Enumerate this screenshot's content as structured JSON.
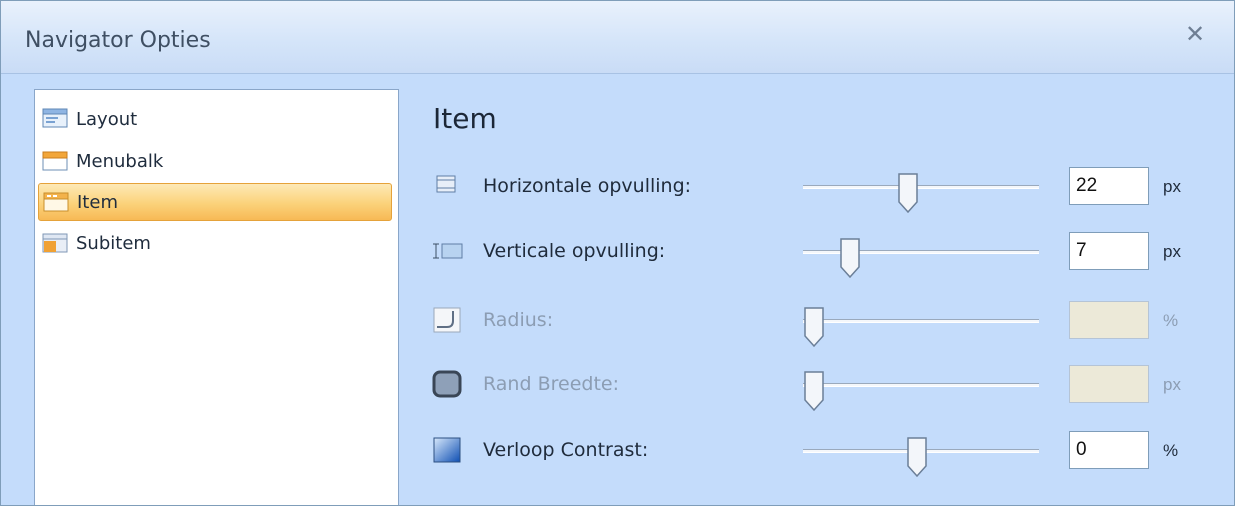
{
  "window": {
    "title": "Navigator Opties",
    "close_glyph": "✕"
  },
  "nav": {
    "items": [
      {
        "label": "Layout",
        "icon": "layout-icon",
        "selected": false
      },
      {
        "label": "Menubalk",
        "icon": "menubar-icon",
        "selected": false
      },
      {
        "label": "Item",
        "icon": "item-icon",
        "selected": true
      },
      {
        "label": "Subitem",
        "icon": "subitem-icon",
        "selected": false
      }
    ]
  },
  "panel": {
    "heading": "Item",
    "rows": [
      {
        "label": "Horizontale opvulling:",
        "value": "22",
        "unit": "px",
        "enabled": true,
        "slider_fraction": 0.44,
        "icon": "horizontal-padding-icon"
      },
      {
        "label": "Verticale opvulling:",
        "value": "7",
        "unit": "px",
        "enabled": true,
        "slider_fraction": 0.17,
        "icon": "vertical-padding-icon"
      },
      {
        "label": "Radius:",
        "value": "",
        "unit": "%",
        "enabled": false,
        "slider_fraction": 0.0,
        "icon": "radius-icon"
      },
      {
        "label": "Rand Breedte:",
        "value": "",
        "unit": "px",
        "enabled": false,
        "slider_fraction": 0.0,
        "icon": "border-width-icon"
      },
      {
        "label": "Verloop Contrast:",
        "value": "0",
        "unit": "%",
        "enabled": true,
        "slider_fraction": 0.48,
        "icon": "gradient-contrast-icon"
      }
    ]
  },
  "colors": {
    "selection": "#fbd27a",
    "window_bg": "#c4dcfb",
    "disabled_text": "#8c9db3"
  }
}
